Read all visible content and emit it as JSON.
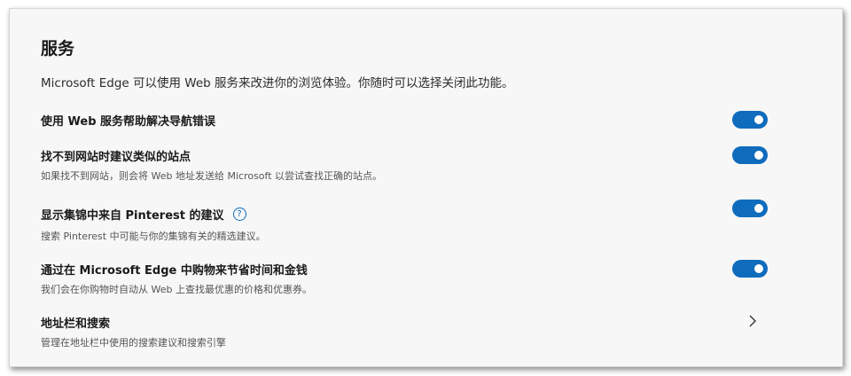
{
  "section": {
    "title": "服务",
    "description": "Microsoft Edge 可以使用 Web 服务来改进你的浏览体验。你随时可以选择关闭此功能。"
  },
  "settings": [
    {
      "label": "使用 Web 服务帮助解决导航错误",
      "sub": "",
      "enabled": true
    },
    {
      "label": "找不到网站时建议类似的站点",
      "sub": "如果找不到网站，则会将 Web 地址发送给 Microsoft 以尝试查找正确的站点。",
      "enabled": true
    },
    {
      "label": "显示集锦中来自 Pinterest 的建议",
      "sub": "搜索 Pinterest 中可能与你的集锦有关的精选建议。",
      "enabled": true,
      "help_glyph": "?"
    },
    {
      "label": "通过在 Microsoft Edge 中购物来节省时间和金钱",
      "sub": "我们会在你购物时自动从 Web 上查找最优惠的价格和优惠券。",
      "enabled": true
    }
  ],
  "address_bar": {
    "label": "地址栏和搜索",
    "sub": "管理在地址栏中使用的搜索建议和搜索引擎"
  },
  "colors": {
    "accent": "#0f6cbd",
    "card_bg": "#f7f7f7"
  }
}
